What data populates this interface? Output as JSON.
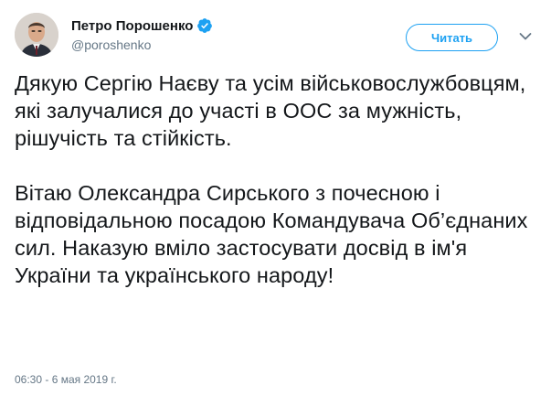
{
  "author": {
    "display_name": "Петро Порошенко",
    "handle": "@poroshenko",
    "verified_icon": "verified-badge-icon",
    "avatar": "profile-photo"
  },
  "actions": {
    "follow_label": "Читать",
    "menu_icon": "chevron-down-icon"
  },
  "tweet": {
    "paragraph_1": "Дякую Сергію Наєву та усім військовослужбовцям, які залучалися до участі в ООС за мужність, рішучість та стійкість.",
    "paragraph_2": "Вітаю Олександра Сирського з почесною і відповідальною посадою Командувача Об’єднаних сил. Наказую вміло застосувати досвід в ім'я України та українського народу!",
    "timestamp": "06:30 - 6 мая 2019 г."
  },
  "colors": {
    "accent": "#1da1f2",
    "text": "#14171a",
    "secondary": "#657786"
  }
}
